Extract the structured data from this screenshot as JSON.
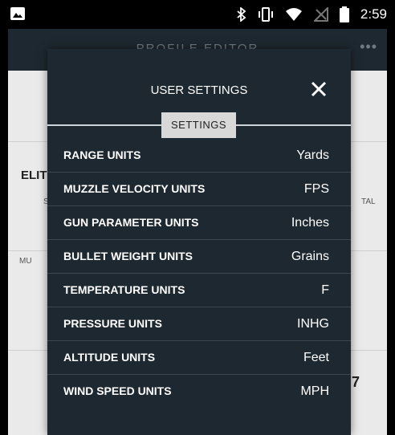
{
  "status_bar": {
    "time": "2:59"
  },
  "app": {
    "header_title": "PROFILE EDITOR",
    "background_texts": {
      "profile_name": "ELIT",
      "left_small": "S",
      "muzzle": "MU",
      "right_tal": "TAL",
      "right_seven": "7"
    }
  },
  "modal": {
    "title": "USER SETTINGS",
    "tab_label": "SETTINGS",
    "rows": [
      {
        "label": "RANGE UNITS",
        "value": "Yards"
      },
      {
        "label": "MUZZLE VELOCITY UNITS",
        "value": "FPS"
      },
      {
        "label": "GUN PARAMETER UNITS",
        "value": "Inches"
      },
      {
        "label": "BULLET WEIGHT UNITS",
        "value": "Grains"
      },
      {
        "label": "TEMPERATURE UNITS",
        "value": "F"
      },
      {
        "label": "PRESSURE UNITS",
        "value": "INHG"
      },
      {
        "label": "ALTITUDE UNITS",
        "value": "Feet"
      },
      {
        "label": "WIND SPEED UNITS",
        "value": "MPH"
      }
    ]
  }
}
